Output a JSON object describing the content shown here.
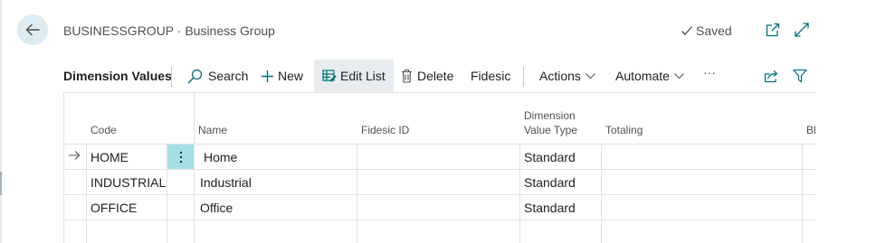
{
  "header": {
    "title": "BUSINESSGROUP · Business Group",
    "saved_label": "Saved"
  },
  "icons": {
    "back": "arrow-left-icon",
    "saved": "checkmark-icon",
    "open_new_window": "open-in-new-window-icon",
    "expand": "expand-icon",
    "search": "search-icon",
    "new": "plus-icon",
    "edit_list": "edit-list-icon",
    "delete": "trash-icon",
    "share": "share-icon",
    "filter": "filter-icon",
    "current_row": "arrow-right-icon",
    "row_menu": "vertical-ellipsis-icon"
  },
  "action_bar": {
    "page_caption": "Dimension Values",
    "search": "Search",
    "new": "New",
    "edit_list": "Edit List",
    "delete": "Delete",
    "fidesic": "Fidesic",
    "actions": "Actions",
    "automate": "Automate",
    "more": "···"
  },
  "table": {
    "columns": {
      "code": "Code",
      "name": "Name",
      "fidesic_id": "Fidesic ID",
      "dimension_value_type_1": "Dimension",
      "dimension_value_type_2": "Value Type",
      "totaling": "Totaling",
      "blocked_partial": "Bl"
    },
    "rows": [
      {
        "code": "HOME",
        "name": "Home",
        "fidesic_id": "",
        "dimension_value_type": "Standard",
        "totaling": ""
      },
      {
        "code": "INDUSTRIAL",
        "name": "Industrial",
        "fidesic_id": "",
        "dimension_value_type": "Standard",
        "totaling": ""
      },
      {
        "code": "OFFICE",
        "name": "Office",
        "fidesic_id": "",
        "dimension_value_type": "Standard",
        "totaling": ""
      }
    ]
  },
  "colors": {
    "accent": "#00707a",
    "back_button_bg": "#dcecf0",
    "selected_cell_bg": "#a6dfe6",
    "edit_list_bg": "#e8ecef",
    "grid_line": "#e1e1e1"
  }
}
